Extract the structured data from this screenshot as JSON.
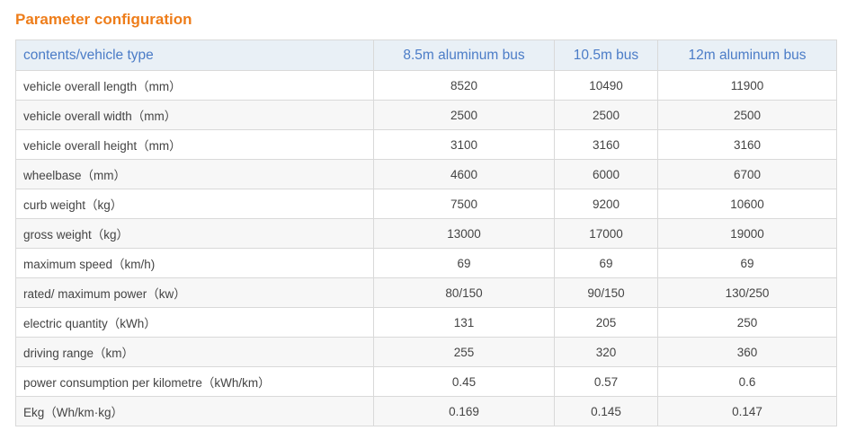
{
  "title": "Parameter configuration",
  "table": {
    "headers": [
      "contents/vehicle type",
      "8.5m aluminum bus",
      "10.5m bus",
      "12m aluminum bus"
    ],
    "rows": [
      [
        "vehicle overall length（mm）",
        "8520",
        "10490",
        "11900"
      ],
      [
        "vehicle overall width（mm）",
        "2500",
        "2500",
        "2500"
      ],
      [
        "vehicle overall height（mm）",
        "3100",
        "3160",
        "3160"
      ],
      [
        "wheelbase（mm）",
        "4600",
        "6000",
        "6700"
      ],
      [
        "curb weight（kg）",
        "7500",
        "9200",
        "10600"
      ],
      [
        "gross weight（kg）",
        "13000",
        "17000",
        "19000"
      ],
      [
        "maximum speed（km/h)",
        "69",
        "69",
        "69"
      ],
      [
        "rated/ maximum power（kw）",
        "80/150",
        "90/150",
        "130/250"
      ],
      [
        "electric quantity（kWh）",
        "131",
        "205",
        "250"
      ],
      [
        "driving range（km）",
        "255",
        "320",
        "360"
      ],
      [
        "power consumption per kilometre（kWh/km）",
        "0.45",
        "0.57",
        "0.6"
      ],
      [
        "Ekg（Wh/km·kg）",
        "0.169",
        "0.145",
        "0.147"
      ]
    ]
  },
  "colors": {
    "title": "#ee7d1a",
    "header_bg": "#e9f0f6",
    "header_text": "#4b7cc7",
    "row_alt_bg": "#f7f7f7",
    "border": "#d9d9d9"
  }
}
